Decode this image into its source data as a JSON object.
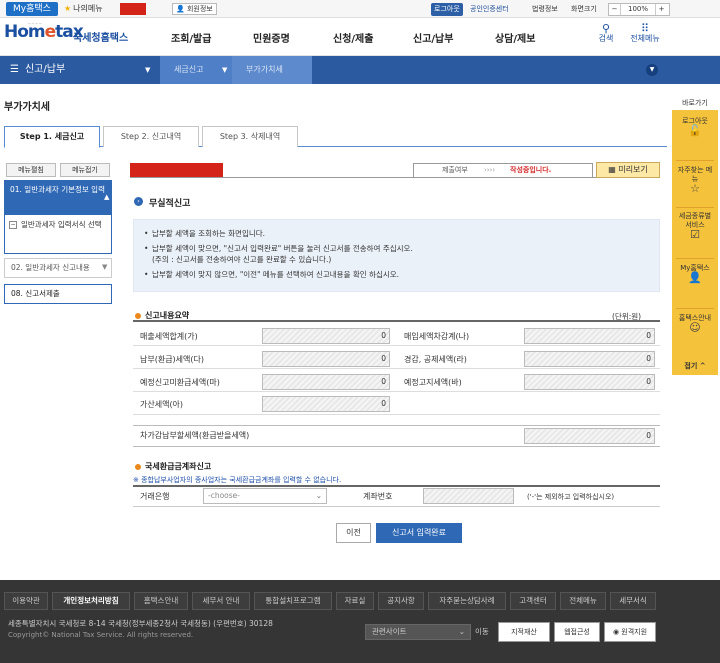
{
  "topbar": {
    "my_hometax": "My홈택스",
    "my_menu": "나의메뉴",
    "user_info": "회원정보",
    "logout": "로그아웃",
    "certificate_center": "공인인증센터",
    "law_info": "법령정보",
    "zoom_label": "화면크기",
    "zoom_minus": "−",
    "zoom_value": "100%",
    "zoom_plus": "+"
  },
  "header": {
    "logo_text": "Hom",
    "logo_accent": "e",
    "logo_text2": "tax",
    "logo_sub": "국세청홈택스",
    "gnb": [
      "조회/발급",
      "민원증명",
      "신청/제출",
      "신고/납부",
      "상담/제보"
    ],
    "search_label": "검색",
    "all_menu_label": "전체메뉴"
  },
  "navbar": {
    "main": "신고/납부",
    "crumb1": "세금신고",
    "crumb2": "부가가치세"
  },
  "page": {
    "title": "부가가치세",
    "steps": [
      "Step 1. 세금신고",
      "Step 2. 신고내역",
      "Step 3. 삭제내역"
    ]
  },
  "left_menu": {
    "expand": "메뉴펼침",
    "collapse": "메뉴접기",
    "item1": "01. 일반과세자 기본정보 입력",
    "item1_sub": "일반과세자 입력서식 선택",
    "item2": "02. 일반과세자 신고내용",
    "item3": "08. 신고서제출"
  },
  "status": {
    "submit_label": "제출여부",
    "arrows": "››››",
    "submit_state": "작성중입니다.",
    "preview": "미리보기"
  },
  "no_report": {
    "title": "무실적신고",
    "lines": [
      "납부할 세액을 조회하는 화면입니다.",
      "납부할 세액이 맞으면, \"신고서 입력완료\" 버튼을 눌러 신고서를 전송하여 주십시오.",
      "(주의 : 신고서를 전송하여야 신고를 완료할 수 있습니다.)",
      "납부할 세액이 맞지 않으면, \"이전\" 메뉴를 선택하여 신고내용을 확인 하십시오."
    ]
  },
  "summary": {
    "title": "신고내용요약",
    "unit": "(단위:원)",
    "rows": [
      {
        "l1": "매출세액합계(가)",
        "v1": "0",
        "l2": "매입세액차감계(나)",
        "v2": "0"
      },
      {
        "l1": "납부(환급)세액(다)",
        "v1": "0",
        "l2": "경감, 공제세액(라)",
        "v2": "0"
      },
      {
        "l1": "예정신고미환급세액(마)",
        "v1": "0",
        "l2": "예정고지세액(바)",
        "v2": "0"
      },
      {
        "l1": "가산세액(아)",
        "v1": "0"
      }
    ],
    "net_label": "차가감납부할세액(환급받을세액)",
    "net_value": "0"
  },
  "refund": {
    "title": "국세환급금계좌신고",
    "note": "※ 종합납부사업자의 종사업자는 국세환급금계좌를 입력할 수 없습니다.",
    "bank_label": "거래은행",
    "bank_selected": "-choose-",
    "account_label": "계좌번호",
    "account_hint": "('-'는 제외하고 입력하십시오)"
  },
  "buttons": {
    "prev": "이전",
    "complete": "신고서 입력완료"
  },
  "quick_menu": {
    "title": "바로가기",
    "items": [
      "로그아웃",
      "자주찾는 메뉴",
      "세금종류별 서비스",
      "My홈택스",
      "홈택스안내"
    ],
    "collapse": "접기 ^"
  },
  "footer": {
    "links": [
      "이용약관",
      "개인정보처리방침",
      "홈택스안내",
      "세무서 안내",
      "통합설치프로그램",
      "자료실",
      "공지사항",
      "자주묻는상담사례",
      "고객센터",
      "전체메뉴",
      "세무서식"
    ],
    "address": "세종특별자치시 국세청로 8-14 국세청(정부세종2청사 국세청동) (우편번호) 30128",
    "copyright": "Copyright© National Tax Service. All rights reserved.",
    "related_site": "관련사이트",
    "go": "이동",
    "badges": [
      "지적재산",
      "웹접근성",
      "원격지원"
    ]
  },
  "colors": {
    "brand_blue": "#2b5aa0",
    "accent_red": "#d4241a",
    "quick_yellow": "#f5c23b",
    "warning_red": "#d42a2a"
  }
}
